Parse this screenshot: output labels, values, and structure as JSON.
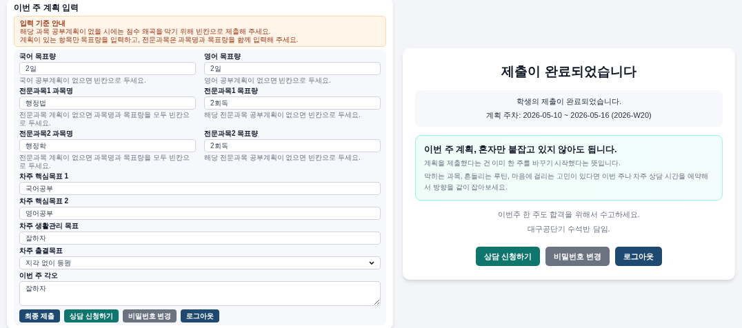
{
  "form": {
    "title": "이번 주 계획 입력",
    "notice": {
      "title": "입력 기준 안내",
      "lines": [
        "해당 과목 공부계획이 없을 시에는 점수 왜곡을 막기 위해 빈칸으로 제출해 주세요.",
        "계획이 있는 항목만 목표량을 입력하고, 전문과목은 과목명과 목표량을 함께 입력해 주세요."
      ]
    },
    "pairs": [
      {
        "left": {
          "label": "국어 목표량",
          "value": "2일",
          "hint": "국어 공부계획이 없으면 빈칸으로 두세요."
        },
        "right": {
          "label": "영어 목표량",
          "value": "2일",
          "hint": "영어 공부계획이 없으면 빈칸으로 두세요."
        }
      },
      {
        "left": {
          "label": "전문과목1 과목명",
          "value": "행정법",
          "hint": "전문과목 계획이 없으면 과목명과 목표량을 모두 빈칸으로 두세요."
        },
        "right": {
          "label": "전문과목1 목표량",
          "value": "2회독",
          "hint": "해당 전문과목 공부계획이 없으면 빈칸으로 두세요."
        }
      },
      {
        "left": {
          "label": "전문과목2 과목명",
          "value": "행정학",
          "hint": "전문과목 계획이 없으면 과목명과 목표량을 모두 빈칸으로 두세요."
        },
        "right": {
          "label": "전문과목2 목표량",
          "value": "2회독",
          "hint": "해당 전문과목 공부계획이 없으면 빈칸으로 두세요."
        }
      }
    ],
    "fields": [
      {
        "kind": "text",
        "label": "차주 핵심목표 1",
        "value": "국어공부"
      },
      {
        "kind": "text",
        "label": "차주 핵심목표 2",
        "value": "영어공부"
      },
      {
        "kind": "text",
        "label": "차주 생활관리 목표",
        "value": "잘하자"
      },
      {
        "kind": "select",
        "label": "차주 출결목표",
        "value": "지각 없이 등원"
      },
      {
        "kind": "textarea",
        "label": "이번 주 각오",
        "value": "잘하자"
      }
    ],
    "buttons": [
      {
        "label": "최종 제출",
        "color": "#1e4a72"
      },
      {
        "label": "상담 신청하기",
        "color": "#0f766e"
      },
      {
        "label": "비밀번호 변경",
        "color": "#6b7280"
      },
      {
        "label": "로그아웃",
        "color": "#1e4a72"
      }
    ]
  },
  "result": {
    "title": "제출이 완료되었습니다",
    "info_lines": [
      "학생의 제출이 완료되었습니다.",
      "계획 주차: 2026-05-10 ~ 2026-05-16 (2026-W20)"
    ],
    "encouragement": {
      "title": "이번 주 계획, 혼자만 붙잡고 있지 않아도 됩니다.",
      "lines": [
        "계획을 제출했다는 건 이미 한 주를 바꾸기 시작했다는 뜻입니다.",
        "막히는 과목, 흔들리는 루틴, 마음에 걸리는 고민이 있다면 이번 주나 차주 상담 시간을 예약해서 방향을 같이 잡아보세요."
      ]
    },
    "closing_lines": [
      "이번주 한 주도 합격을 위해서 수고하세요.",
      "대구공단기 수석반 담임."
    ],
    "buttons": [
      {
        "label": "상담 신청하기",
        "color": "#0f766e"
      },
      {
        "label": "비밀번호 변경",
        "color": "#6b7280"
      },
      {
        "label": "로그아웃",
        "color": "#1e4a72"
      }
    ]
  }
}
